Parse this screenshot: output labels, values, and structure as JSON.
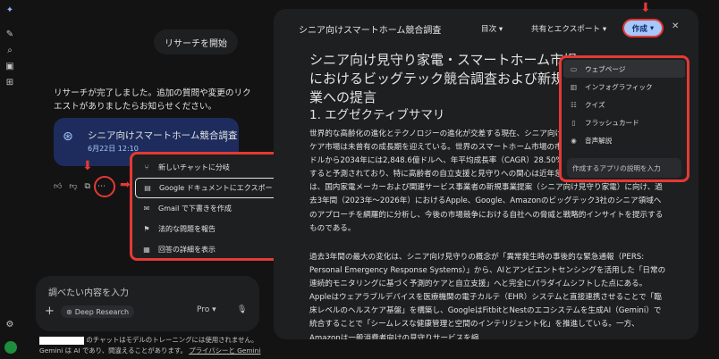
{
  "rail": {
    "icons": [
      "gemini-sparkle-icon",
      "edit-icon",
      "search-icon",
      "gallery-icon",
      "apps-icon",
      "settings-icon"
    ]
  },
  "chat": {
    "start_button": "リサーチを開始",
    "completion_message": "リサーチが完了しました。追加の質問や変更のリクエストがありましたらお知らせください。",
    "research_card": {
      "title": "シニア向けスマートホーム競合調査",
      "date": "6月22日 12:10"
    },
    "more_menu": {
      "items": [
        {
          "label": "新しいチャットに分岐",
          "icon": "branch-icon"
        },
        {
          "label": "Google ドキュメントにエクスポート",
          "icon": "docs-icon",
          "highlighted": true
        },
        {
          "label": "Gmail で下書きを作成",
          "icon": "gmail-icon"
        },
        {
          "label": "法的な問題を報告",
          "icon": "flag-icon"
        },
        {
          "label": "回答の詳細を表示",
          "icon": "details-icon"
        }
      ]
    },
    "input": {
      "placeholder": "調べたい内容を入力",
      "tool_chip": "Deep Research",
      "model": "Pro"
    },
    "footer": {
      "line1": "のチャットはモデルのトレーニングには使用されません。",
      "line2": "Gemini は AI であり、間違えることがあります。",
      "link": "プライバシーと Gemini"
    }
  },
  "panel": {
    "header_title": "シニア向けスマートホーム競合調査",
    "toc_label": "目次",
    "share_label": "共有とエクスポート",
    "create_label": "作成",
    "doc_title": "シニア向け見守り家電・スマートホーム市場におけるビッグテック競合調査および新規事業への提言",
    "section_title": "1. エグゼクティブサマリ",
    "paragraph1": "世界的な高齢化の進化とテクノロジーの進化が交差する現在、シニア向けスマートホームおよびヘルスケア市場は未曾有の成長期を迎えている。世界のスマートホーム市場の市場規模は、2025年の297.3億ドルから2034年には2,848.6億ドルへ、年平均成長率（CAGR）28.50%という驚異的なペースで拡大すると予測されており、特に高齢者の自立支援と見守りへの関心は近年急激に高まっている。本報告書は、国内家電メーカーおよび関連サービス事業者の新規事業提案（シニア向け見守り家電）に向け、過去3年間（2023年〜2026年）におけるApple、Google、Amazonのビッグテック3社のシニア領域へのアプローチを網羅的に分析し、今後の市場競争における自社への脅威と戦略的インサイトを提示するものである。",
    "paragraph2": "過去3年間の最大の変化は、シニア向け見守りの概念が「異常発生時の事後的な緊急通報（PERS: Personal Emergency Response Systems）」から、AIとアンビエントセンシングを活用した「日常の連続的モニタリングに基づく予測的ケアと自立支援」へと完全にパラダイムシフトした点にある。Appleはウェアラブルデバイスを医療機関の電子カルテ（EHR）システムと直接連携させることで「臨床レベルのヘルスケア基盤」を構築し、GoogleはFitbitとNestのエコシステムを生成AI（Gemini）で統合することで「シームレスな健康管理と空間のインテリジェント化」を推進している。一方、Amazonは一般消費者向けの見守りサービスを縮",
    "create_menu": {
      "items": [
        {
          "label": "ウェブページ",
          "icon": "webpage-icon",
          "selected": true
        },
        {
          "label": "インフォグラフィック",
          "icon": "infographic-icon"
        },
        {
          "label": "クイズ",
          "icon": "quiz-icon"
        },
        {
          "label": "フラッシュカード",
          "icon": "flashcard-icon"
        },
        {
          "label": "音声解説",
          "icon": "audio-icon"
        }
      ],
      "input_placeholder": "作成するアプリの説明を入力"
    }
  },
  "colors": {
    "background": "#131314",
    "panel": "#1e1f20",
    "accent": "#a8c7fa",
    "highlight": "#e53935"
  }
}
